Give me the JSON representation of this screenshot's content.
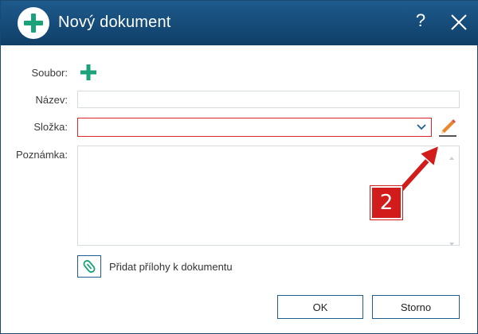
{
  "dialog": {
    "title": "Nový dokument",
    "help_label": "?",
    "icons": {
      "title": "plus-circle-icon",
      "close": "close-icon"
    },
    "colors": {
      "titlebar": "#1a4f7e",
      "accent_green": "#1aa37a",
      "error_border": "#d9252b",
      "button_border": "#1f5d8e"
    }
  },
  "form": {
    "soubor_label": "Soubor:",
    "nazev_label": "Název:",
    "nazev_value": "",
    "slozka_label": "Složka:",
    "slozka_value": "",
    "poznamka_label": "Poznámka:",
    "poznamka_value": "",
    "attach_label": "Přidat přílohy k dokumentu"
  },
  "buttons": {
    "ok": "OK",
    "storno": "Storno"
  },
  "annotation": {
    "badge_number": "2",
    "color": "#d21c1c"
  }
}
